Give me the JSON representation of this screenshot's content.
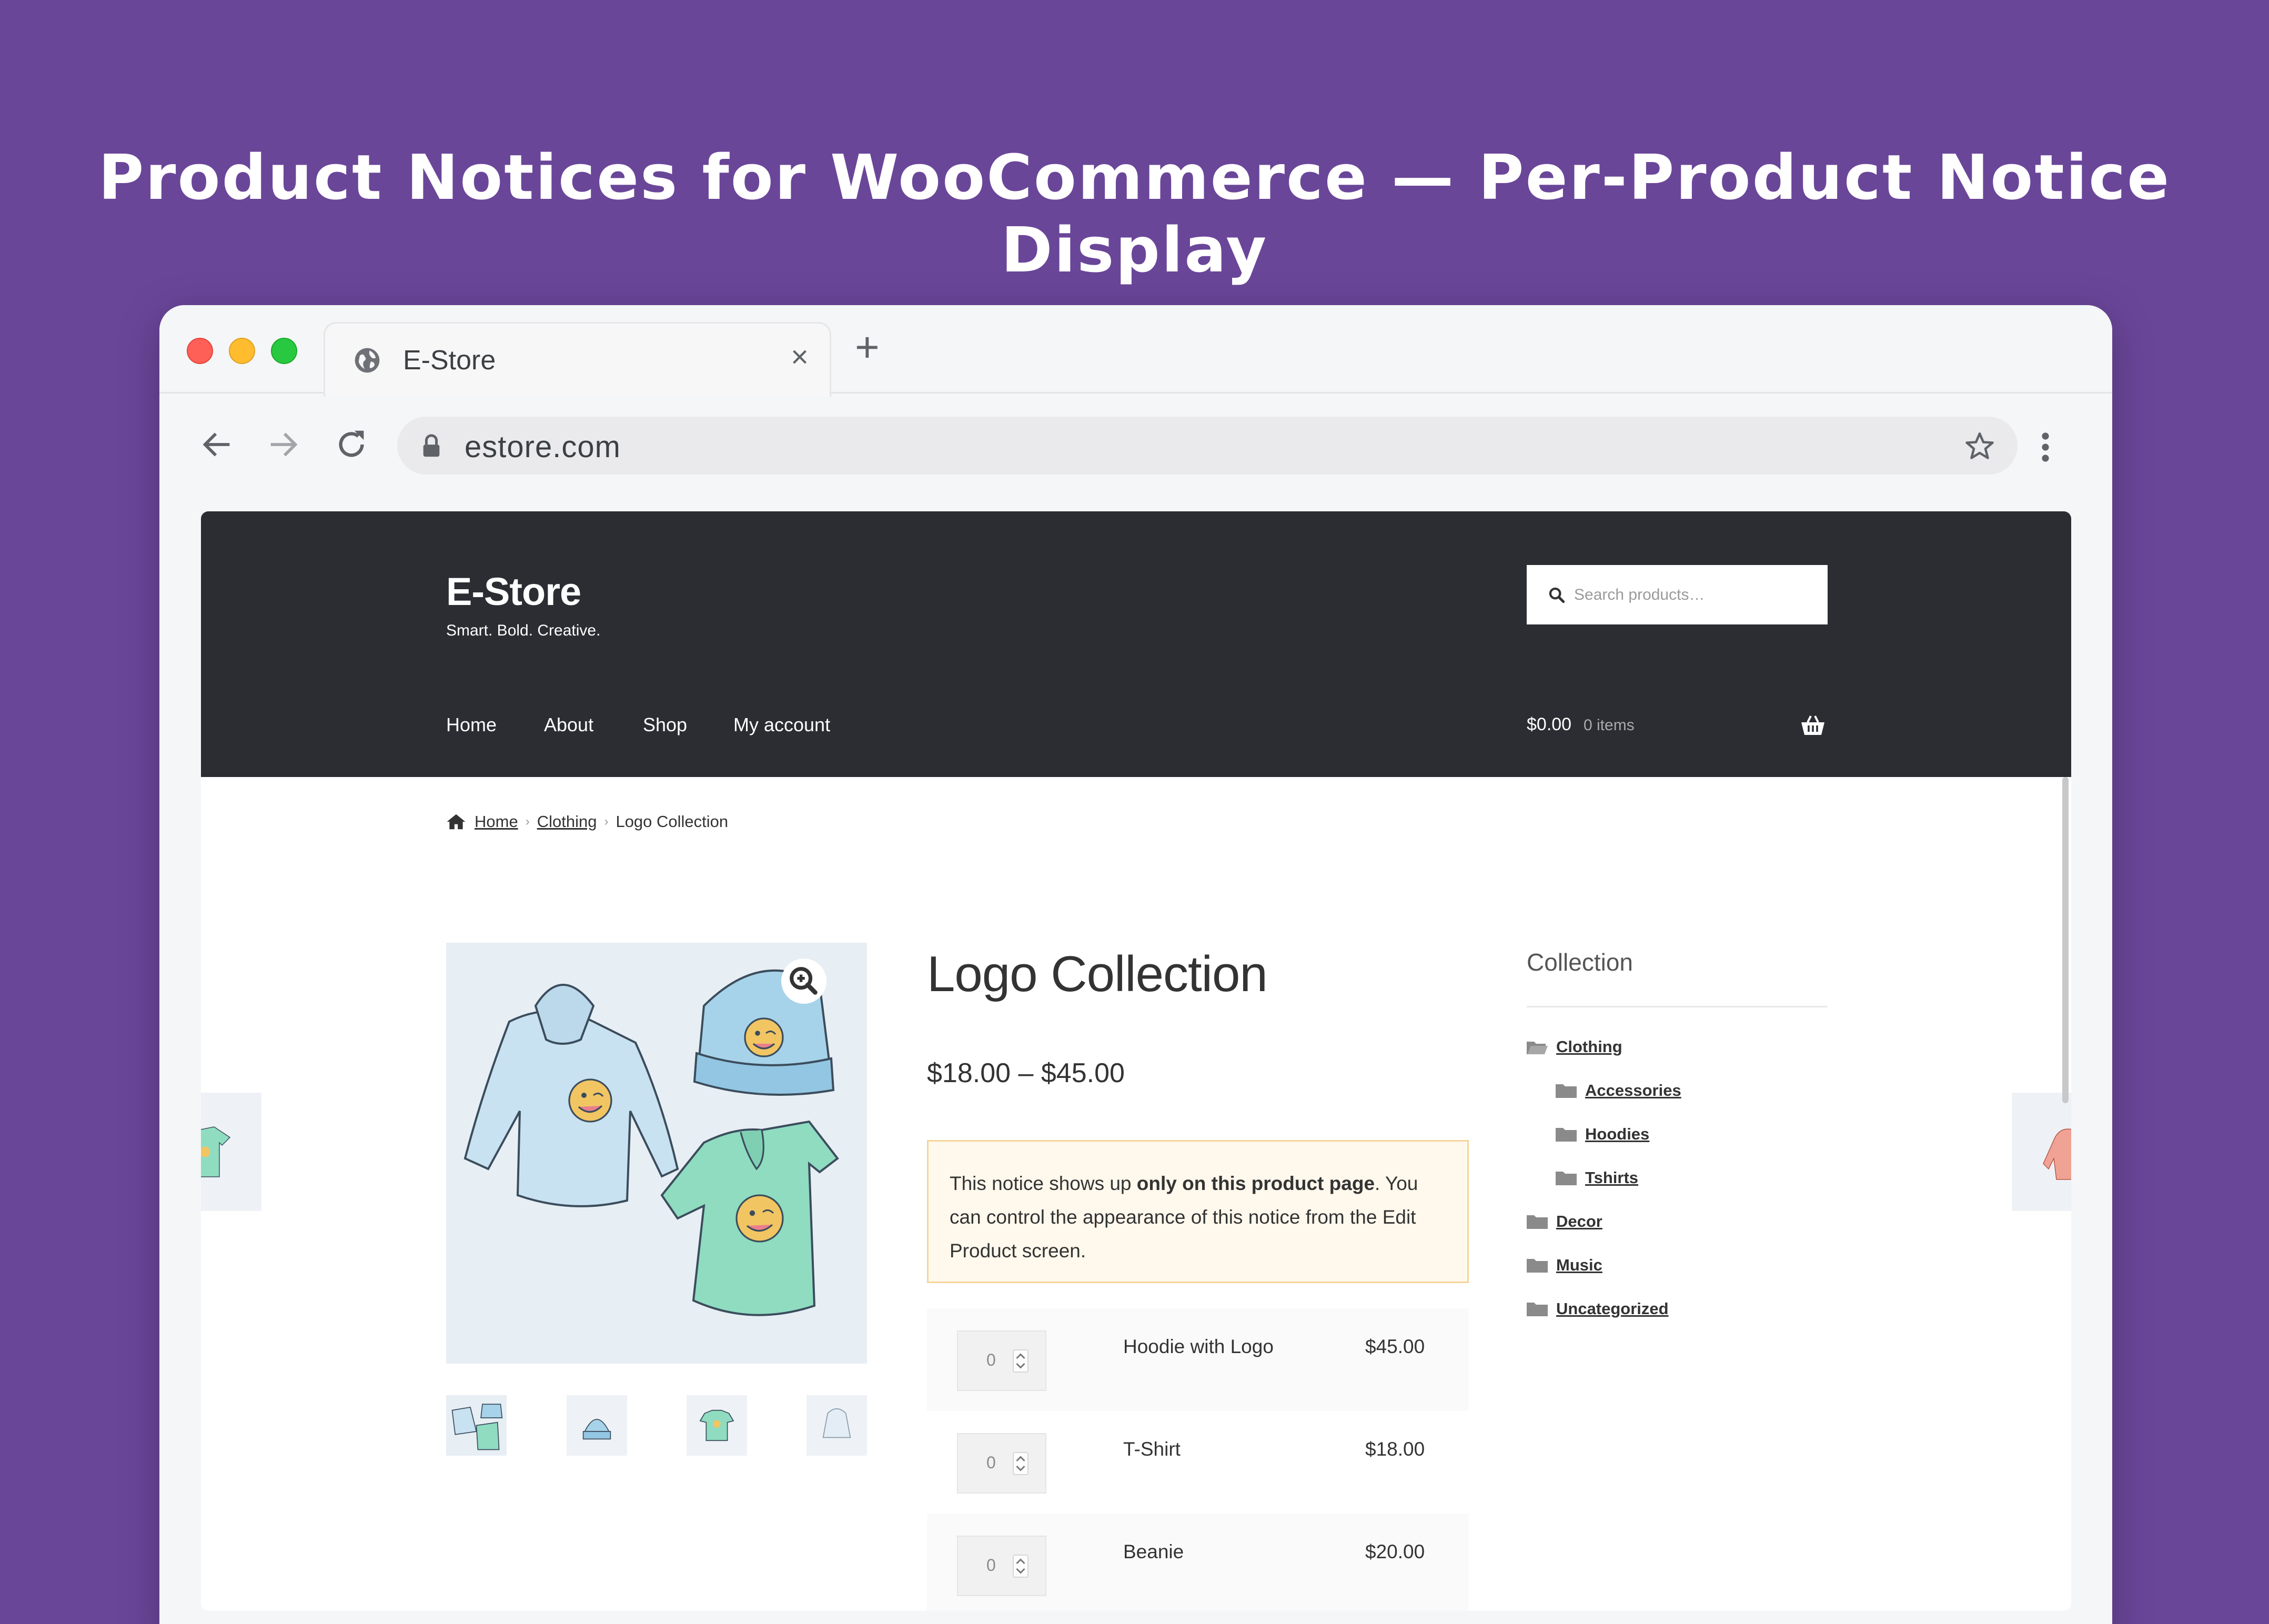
{
  "banner": {
    "title": "Product Notices for WooCommerce — Per-Product Notice Display"
  },
  "browser": {
    "tab_title": "E-Store",
    "url": "estore.com"
  },
  "site": {
    "title": "E-Store",
    "tagline": "Smart. Bold. Creative.",
    "search_placeholder": "Search products…",
    "nav": [
      "Home",
      "About",
      "Shop",
      "My account"
    ],
    "cart_total": "$0.00",
    "cart_count": "0 items"
  },
  "breadcrumb": {
    "home": "Home",
    "category": "Clothing",
    "current": "Logo Collection"
  },
  "product": {
    "title": "Logo Collection",
    "price": "$18.00 – $45.00",
    "notice": {
      "before": "This notice shows up ",
      "bold": "only on this product page",
      "after": ". You can control the appearance of this notice from the Edit Product screen."
    },
    "grouped": [
      {
        "qty": "0",
        "name": "Hoodie with Logo",
        "price": "$45.00"
      },
      {
        "qty": "0",
        "name": "T-Shirt",
        "price": "$18.00"
      },
      {
        "qty": "0",
        "name": "Beanie",
        "price": "$20.00"
      }
    ]
  },
  "sidebar": {
    "title": "Collection",
    "categories": [
      {
        "label": "Clothing",
        "level": 0,
        "open": true
      },
      {
        "label": "Accessories",
        "level": 1
      },
      {
        "label": "Hoodies",
        "level": 1
      },
      {
        "label": "Tshirts",
        "level": 1
      },
      {
        "label": "Decor",
        "level": 0
      },
      {
        "label": "Music",
        "level": 0
      },
      {
        "label": "Uncategorized",
        "level": 0
      }
    ]
  },
  "colors": {
    "banner_bg": "#6a4699",
    "header_bg": "#2c2d33",
    "notice_bg": "#fff8ec",
    "notice_border": "#f5d59c"
  }
}
